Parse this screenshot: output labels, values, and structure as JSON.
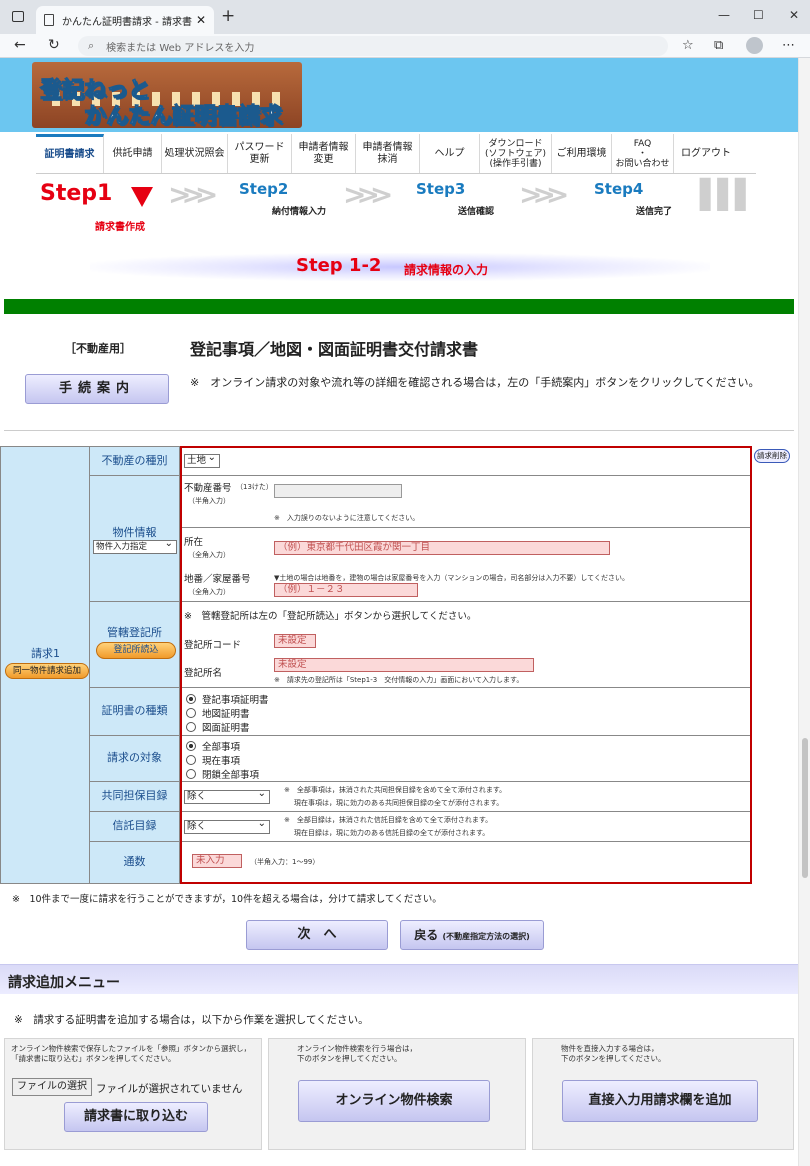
{
  "browser": {
    "tab_title": "かんたん証明書請求 - 請求書作成",
    "tab_close": "✕",
    "new_tab": "+",
    "address_placeholder": "検索または Web アドレスを入力"
  },
  "header": {
    "logo_line1": "登記ねっと",
    "logo_line2": "かんたん証明書請求"
  },
  "menu": [
    "証明書請求",
    "供託申請",
    "処理状況照会",
    "パスワード\n更新",
    "申請者情報\n変更",
    "申請者情報\n抹消",
    "ヘルプ",
    "ダウンロード\n(ソフトウェア)\n(操作手引書)",
    "ご利用環境",
    "FAQ\n・\nお問い合わせ",
    "ログアウト"
  ],
  "steps": {
    "step1": "Step1",
    "step1_sub": "請求書作成",
    "step2": "Step2",
    "step2_sub": "納付情報入力",
    "step3": "Step3",
    "step3_sub": "送信確認",
    "step4": "Step4",
    "step4_sub": "送信完了",
    "current_num": "Step 1-2",
    "current_title": "請求情報の入力"
  },
  "page": {
    "kind": "［不動産用］",
    "title": "登記事項／地図・図面証明書交付請求書",
    "guide_button": "手続案内",
    "guide_note": "※　オンライン請求の対象や流れ等の詳細を確認される場合は，左の「手続案内」ボタンをクリックしてください。"
  },
  "form": {
    "request_label": "請求1",
    "same_property_button": "同一物件請求追加",
    "delete_button": "請求削除",
    "rows": {
      "property_type": {
        "label": "不動産の種別",
        "value": "土地"
      },
      "property_info": {
        "label": "物件情報",
        "mode": "物件入力指定",
        "number_label": "不動産番号",
        "number_hint": "（13けた）",
        "halfwidth": "（半角入力）",
        "number_note": "※　入力誤りのないように注意してください。",
        "location_label": "所在",
        "fullwidth": "（全角入力）",
        "location_placeholder": "（例）東京都千代田区霞が関一丁目",
        "lot_label": "地番／家屋番号",
        "lot_note": "▼土地の場合は地番を，建物の場合は家屋番号を入力（マンションの場合，司名部分は入力不要）してください。",
        "lot_placeholder": "（例）１－２３"
      },
      "registry": {
        "label": "管轄登記所",
        "button": "登記所読込",
        "note": "※　管轄登記所は左の「登記所読込」ボタンから選択してください。",
        "code_label": "登記所コード",
        "code_value": "未設定",
        "name_label": "登記所名",
        "name_value": "未設定",
        "sub_note": "※　請求先の登記所は「Step1-3　交付情報の入力」画面において入力します。"
      },
      "cert_type": {
        "label": "証明書の種類",
        "options": [
          "登記事項証明書",
          "地図証明書",
          "図面証明書"
        ],
        "selected": 0
      },
      "target": {
        "label": "請求の対象",
        "options": [
          "全部事項",
          "現在事項",
          "閉鎖全部事項"
        ],
        "selected": 0
      },
      "collateral": {
        "label": "共同担保目録",
        "value": "除く",
        "note1": "※　全部事項は，抹消された共同担保目録を含めて全て添付されます。",
        "note2": "現在事項は，現に効力のある共同担保目録の全てが添付されます。"
      },
      "trust": {
        "label": "信託目録",
        "value": "除く",
        "note1": "※　全部目録は，抹消された信託目録を含めて全て添付されます。",
        "note2": "現在目録は，現に効力のある信託目録の全てが添付されます。"
      },
      "count": {
        "label": "通数",
        "value": "未入力",
        "hint": "（半角入力：1～99）"
      }
    }
  },
  "bottom": {
    "note": "※　10件まで一度に請求を行うことができますが，10件を超える場合は，分けて請求してください。",
    "next": "次　へ",
    "back": "戻る",
    "back_sub": "(不動産指定方法の選択)"
  },
  "add_menu": {
    "title": "請求追加メニュー",
    "note": "※　請求する証明書を追加する場合は，以下から作業を選択してください。",
    "panel1_note": "オンライン物件検索で保存したファイルを「参照」ボタンから選択し，\n「請求書に取り込む」ボタンを押してください。",
    "file_button": "ファイルの選択",
    "file_status": "ファイルが選択されていません",
    "import_button": "請求書に取り込む",
    "panel2_note": "オンライン物件検索を行う場合は，\n下のボタンを押してください。",
    "search_button": "オンライン物件検索",
    "panel3_note": "物件を直接入力する場合は，\n下のボタンを押してください。",
    "direct_button": "直接入力用請求欄を追加"
  },
  "colors": {
    "accent_red": "#e60012",
    "step_blue": "#1a7bbf",
    "green_bar": "#008000",
    "frame_red": "#c00000"
  }
}
